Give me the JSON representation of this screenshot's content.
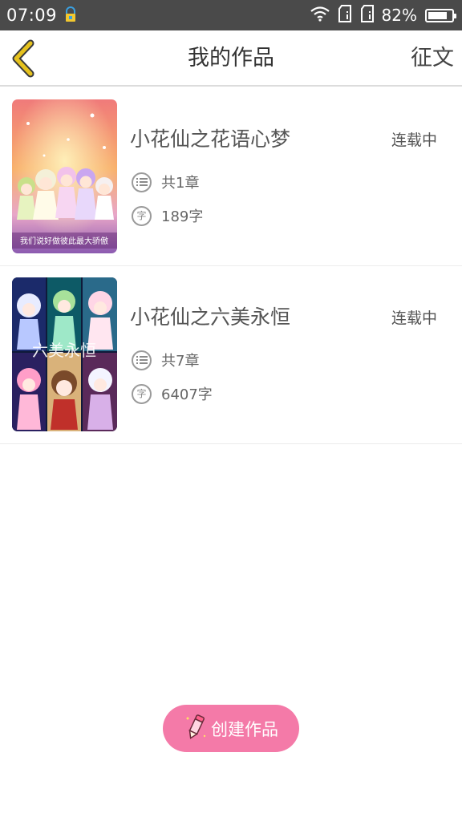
{
  "status_bar": {
    "time": "07:09",
    "battery_text": "82%",
    "battery_level": 0.82
  },
  "header": {
    "title": "我的作品",
    "right_action": "征文",
    "accent_color": "#e6c21e"
  },
  "works": [
    {
      "title": "小花仙之花语心梦",
      "status": "连载中",
      "chapters": "共1章",
      "words": "189字",
      "cover_caption": "我们说好做彼此最大骄傲"
    },
    {
      "title": "小花仙之六美永恒",
      "status": "连载中",
      "chapters": "共7章",
      "words": "6407字",
      "cover_caption": "六美永恒"
    }
  ],
  "icons": {
    "chapters": "list-icon",
    "words": "character-count-icon",
    "word_glyph": "字"
  },
  "create_button": {
    "label": "创建作品",
    "color": "#f47aa8"
  }
}
